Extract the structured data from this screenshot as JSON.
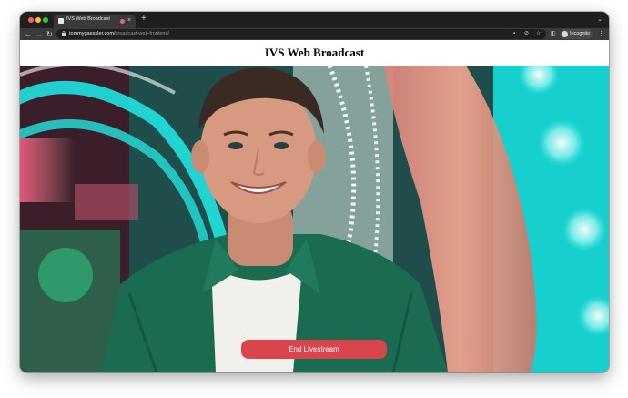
{
  "browser": {
    "tab_title": "IVS Web Broadcast",
    "new_tab_icon": "plus-icon",
    "url_host": "tommygaessler.com",
    "url_path": "/broadcast-web-frontend/",
    "profile_label": "Incognito"
  },
  "page": {
    "title": "IVS Web Broadcast",
    "end_button_label": "End Livestream",
    "accent_color": "#d9454c"
  },
  "video": {
    "subject": "smiling young man in green shirt in front of neon lights"
  }
}
